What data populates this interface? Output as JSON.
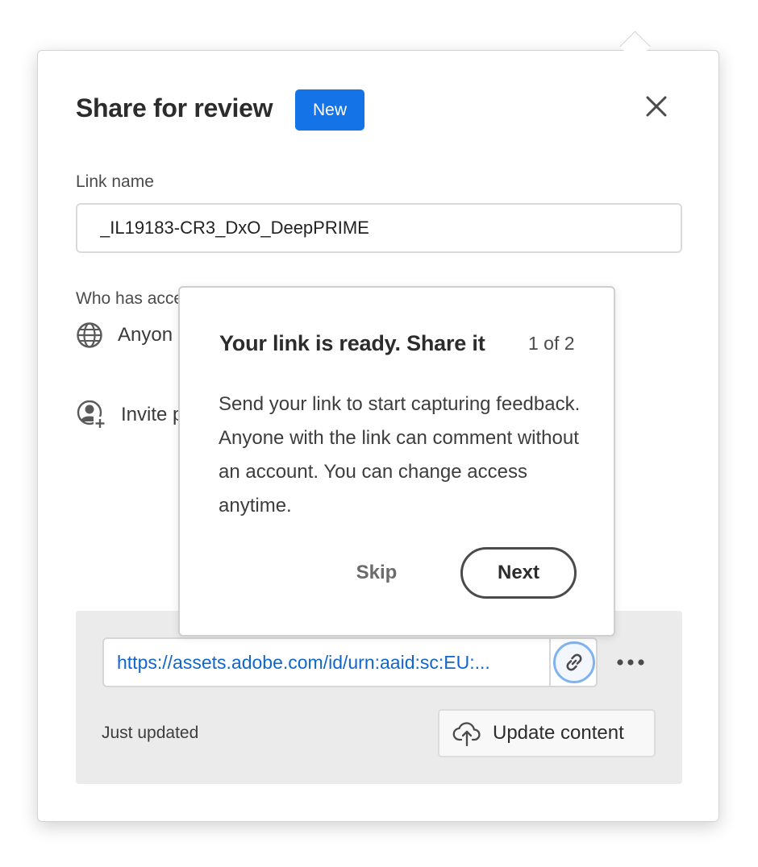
{
  "dialog": {
    "title": "Share for review",
    "badge": "New",
    "link_name_label": "Link name",
    "link_name_value": "_IL19183-CR3_DxO_DeepPRIME",
    "access_label": "Who has acce",
    "access_option": "Anyon",
    "invite_label": "Invite p",
    "icons": {
      "close": "close-icon",
      "globe": "globe-icon",
      "invite": "add-person-icon",
      "link": "link-icon",
      "more": "more-icon",
      "upload": "cloud-upload-icon"
    }
  },
  "link_panel": {
    "url": "https://assets.adobe.com/id/urn:aaid:sc:EU:...",
    "status": "Just updated",
    "update_button": "Update content"
  },
  "coachmark": {
    "title": "Your link is ready. Share it",
    "step": "1 of 2",
    "body": "Send your link to start capturing feedback. Anyone with the link can comment without an account. You can change access anytime.",
    "skip_label": "Skip",
    "next_label": "Next"
  },
  "colors": {
    "accent": "#1473e6",
    "link_text": "#1166cc",
    "panel_bg": "#ebebeb",
    "focus_ring": "#7fb2f0"
  }
}
